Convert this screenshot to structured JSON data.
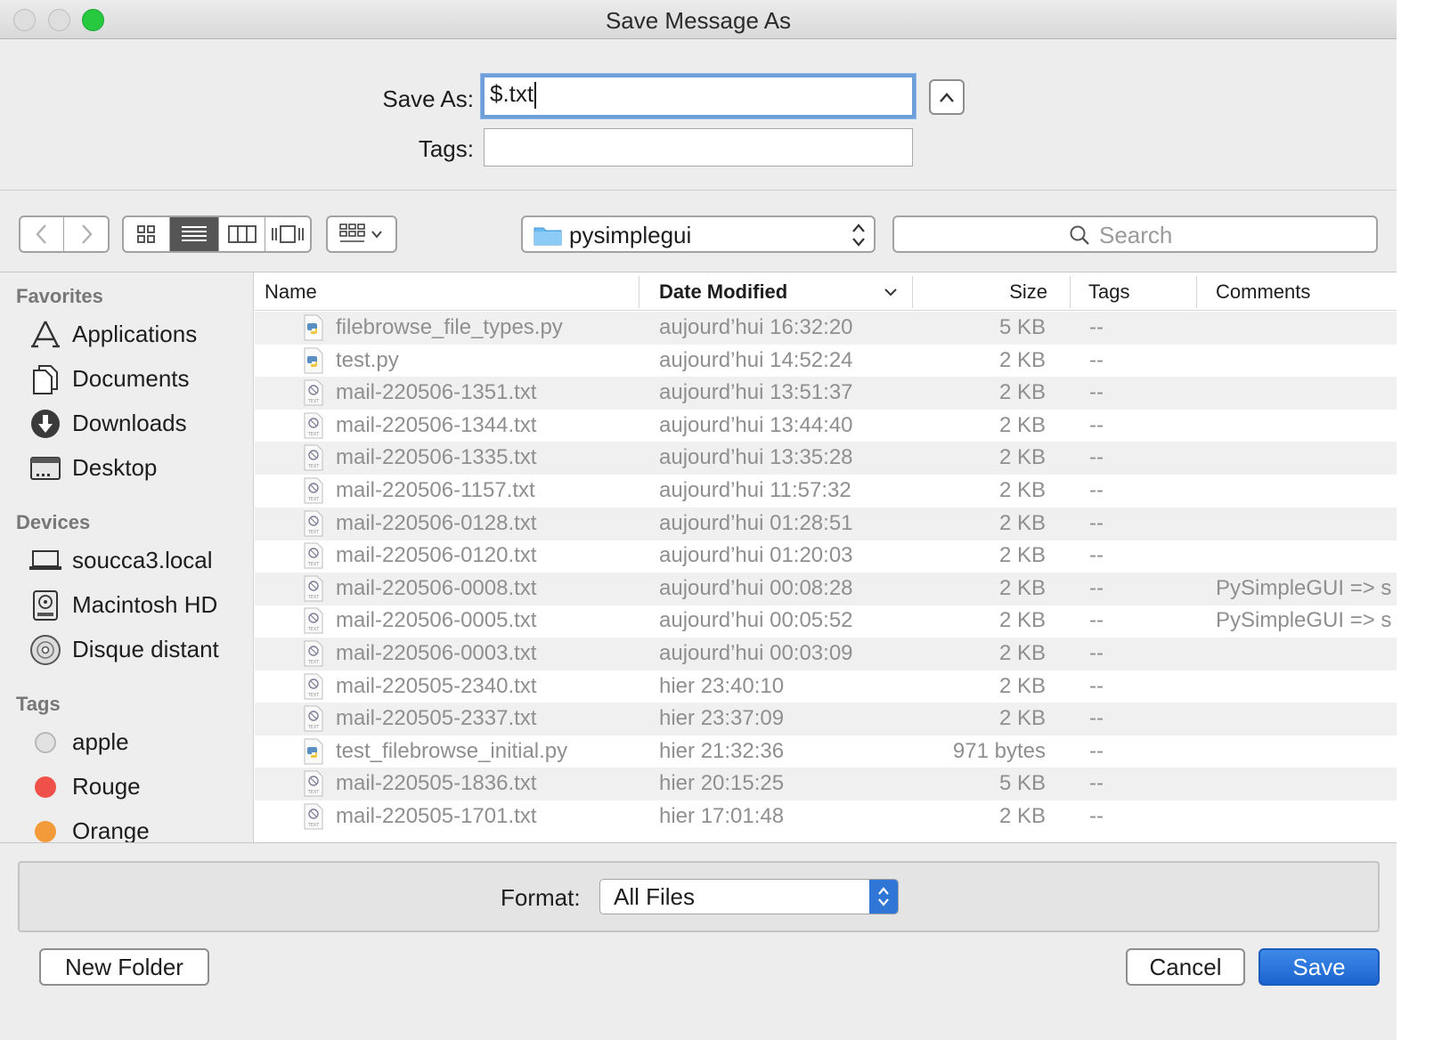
{
  "window": {
    "title": "Save Message As"
  },
  "save_panel": {
    "save_as_label": "Save As:",
    "save_as_value": "$.txt",
    "tags_label": "Tags:",
    "tags_value": ""
  },
  "toolbar": {
    "current_folder": "pysimplegui",
    "search_placeholder": "Search"
  },
  "sidebar": {
    "favorites_heading": "Favorites",
    "favorites": [
      {
        "label": "Applications",
        "icon": "applications-icon"
      },
      {
        "label": "Documents",
        "icon": "documents-icon"
      },
      {
        "label": "Downloads",
        "icon": "downloads-icon"
      },
      {
        "label": "Desktop",
        "icon": "desktop-icon"
      }
    ],
    "devices_heading": "Devices",
    "devices": [
      {
        "label": "soucca3.local",
        "icon": "laptop-icon"
      },
      {
        "label": "Macintosh HD",
        "icon": "hard-drive-icon"
      },
      {
        "label": "Disque distant",
        "icon": "disc-icon"
      }
    ],
    "tags_heading": "Tags",
    "tags": [
      {
        "label": "apple",
        "color": "#d8d8d8"
      },
      {
        "label": "Rouge",
        "color": "#f0504a"
      },
      {
        "label": "Orange",
        "color": "#f39a3a"
      }
    ]
  },
  "file_list": {
    "columns": [
      "Name",
      "Date Modified",
      "Size",
      "Tags",
      "Comments"
    ],
    "rows": [
      {
        "name": "filebrowse_file_types.py",
        "date": "aujourd’hui 16:32:20",
        "size": "5 KB",
        "tags": "--",
        "comments": "",
        "kind": "py"
      },
      {
        "name": "test.py",
        "date": "aujourd’hui 14:52:24",
        "size": "2 KB",
        "tags": "--",
        "comments": "",
        "kind": "py"
      },
      {
        "name": "mail-220506-1351.txt",
        "date": "aujourd’hui 13:51:37",
        "size": "2 KB",
        "tags": "--",
        "comments": "",
        "kind": "txt"
      },
      {
        "name": "mail-220506-1344.txt",
        "date": "aujourd’hui 13:44:40",
        "size": "2 KB",
        "tags": "--",
        "comments": "",
        "kind": "txt"
      },
      {
        "name": "mail-220506-1335.txt",
        "date": "aujourd’hui 13:35:28",
        "size": "2 KB",
        "tags": "--",
        "comments": "",
        "kind": "txt"
      },
      {
        "name": "mail-220506-1157.txt",
        "date": "aujourd’hui 11:57:32",
        "size": "2 KB",
        "tags": "--",
        "comments": "",
        "kind": "txt"
      },
      {
        "name": "mail-220506-0128.txt",
        "date": "aujourd’hui 01:28:51",
        "size": "2 KB",
        "tags": "--",
        "comments": "",
        "kind": "txt"
      },
      {
        "name": "mail-220506-0120.txt",
        "date": "aujourd’hui 01:20:03",
        "size": "2 KB",
        "tags": "--",
        "comments": "",
        "kind": "txt"
      },
      {
        "name": "mail-220506-0008.txt",
        "date": "aujourd’hui 00:08:28",
        "size": "2 KB",
        "tags": "--",
        "comments": "PySimpleGUI => s",
        "kind": "txt"
      },
      {
        "name": "mail-220506-0005.txt",
        "date": "aujourd’hui 00:05:52",
        "size": "2 KB",
        "tags": "--",
        "comments": "PySimpleGUI => s",
        "kind": "txt"
      },
      {
        "name": "mail-220506-0003.txt",
        "date": "aujourd’hui 00:03:09",
        "size": "2 KB",
        "tags": "--",
        "comments": "",
        "kind": "txt"
      },
      {
        "name": "mail-220505-2340.txt",
        "date": "hier 23:40:10",
        "size": "2 KB",
        "tags": "--",
        "comments": "",
        "kind": "txt"
      },
      {
        "name": "mail-220505-2337.txt",
        "date": "hier 23:37:09",
        "size": "2 KB",
        "tags": "--",
        "comments": "",
        "kind": "txt"
      },
      {
        "name": "test_filebrowse_initial.py",
        "date": "hier 21:32:36",
        "size": "971 bytes",
        "tags": "--",
        "comments": "",
        "kind": "py"
      },
      {
        "name": "mail-220505-1836.txt",
        "date": "hier 20:15:25",
        "size": "5 KB",
        "tags": "--",
        "comments": "",
        "kind": "txt"
      },
      {
        "name": "mail-220505-1701.txt",
        "date": "hier 17:01:48",
        "size": "2 KB",
        "tags": "--",
        "comments": "",
        "kind": "txt"
      }
    ]
  },
  "bottom": {
    "format_label": "Format:",
    "format_value": "All Files",
    "new_folder_label": "New Folder",
    "cancel_label": "Cancel",
    "save_label": "Save"
  }
}
